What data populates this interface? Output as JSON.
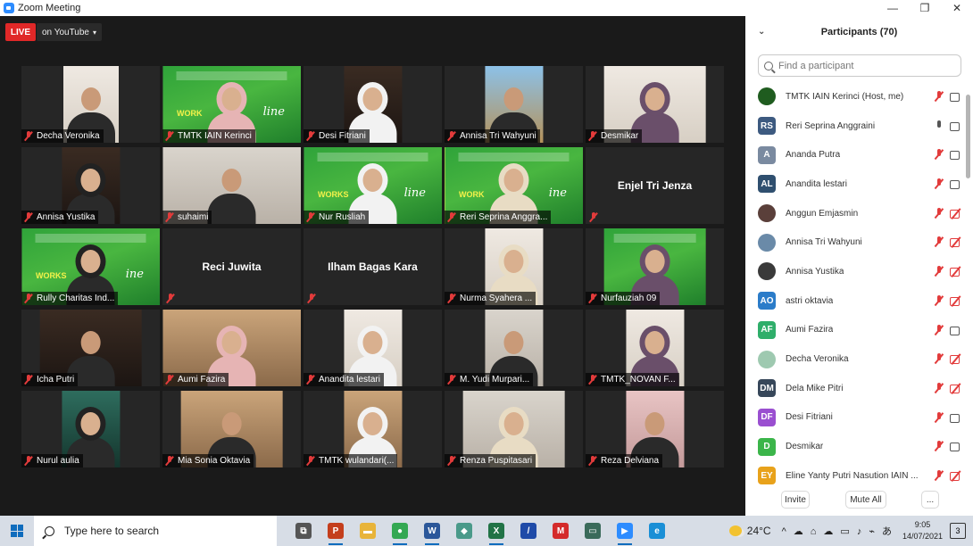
{
  "window": {
    "title": "Zoom Meeting",
    "minimize": "—",
    "restore": "❐",
    "close": "✕"
  },
  "live": {
    "badge": "LIVE",
    "destination": "on YouTube",
    "caret": "▾"
  },
  "tiles": [
    {
      "name": "Decha Veronika",
      "kind": "photo",
      "bg": "v-light",
      "video_width_pct": 40
    },
    {
      "name": "TMTK IAIN Kerinci",
      "kind": "video",
      "bg": "v-green",
      "overlay": "WORK",
      "overlay2": "line"
    },
    {
      "name": "Desi Fitriani",
      "kind": "video",
      "bg": "v-dark",
      "video_width_pct": 42
    },
    {
      "name": "Annisa Tri Wahyuni",
      "kind": "photo",
      "bg": "v-sky",
      "video_width_pct": 42
    },
    {
      "name": "Desmikar",
      "kind": "video",
      "bg": "v-light",
      "video_width_pct": 74
    },
    {
      "name": "Annisa Yustika",
      "kind": "photo",
      "bg": "v-dark",
      "video_width_pct": 42
    },
    {
      "name": "suhaimi",
      "kind": "video",
      "bg": "v-room"
    },
    {
      "name": "Nur Rusliah",
      "kind": "video",
      "bg": "v-green",
      "overlay": "WORKS",
      "overlay2": "line"
    },
    {
      "name": "Reri Seprina Anggra...",
      "kind": "video",
      "bg": "v-green",
      "overlay": "WORK",
      "overlay2": "ine",
      "active": true
    },
    {
      "name": "Enjel Tri Jenza",
      "kind": "nameonly"
    },
    {
      "name": "Rully Charitas Ind...",
      "kind": "video",
      "bg": "v-green",
      "overlay": "WORKS",
      "overlay2": "ine"
    },
    {
      "name": "Reci Juwita",
      "kind": "nameonly"
    },
    {
      "name": "Ilham Bagas Kara",
      "kind": "nameonly"
    },
    {
      "name": "Nurma Syahera ...",
      "kind": "photo",
      "bg": "v-light",
      "video_width_pct": 42
    },
    {
      "name": "Nurfauziah 09",
      "kind": "video",
      "bg": "v-green",
      "video_width_pct": 74
    },
    {
      "name": "Icha Putri",
      "kind": "video",
      "bg": "v-dark",
      "video_width_pct": 74
    },
    {
      "name": "Aumi Fazira",
      "kind": "video",
      "bg": "v-warm"
    },
    {
      "name": "Anandita lestari",
      "kind": "video",
      "bg": "v-light",
      "video_width_pct": 42
    },
    {
      "name": "M. Yudi Murpari...",
      "kind": "video",
      "bg": "v-room",
      "video_width_pct": 42
    },
    {
      "name": "TMTK_NOVAN F...",
      "kind": "video",
      "bg": "v-light",
      "video_width_pct": 42
    },
    {
      "name": "Nurul aulia",
      "kind": "video",
      "bg": "v-teal",
      "video_width_pct": 42
    },
    {
      "name": "Mia Sonia Oktavia",
      "kind": "video",
      "bg": "v-warm",
      "video_width_pct": 74
    },
    {
      "name": "TMTK wulandari(...",
      "kind": "video",
      "bg": "v-warm",
      "video_width_pct": 42
    },
    {
      "name": "Renza Puspitasari",
      "kind": "video",
      "bg": "v-room",
      "video_width_pct": 74
    },
    {
      "name": "Reza Delviana",
      "kind": "video",
      "bg": "v-pink",
      "video_width_pct": 42
    }
  ],
  "participants_panel": {
    "title": "Participants (70)",
    "collapse": "⌄",
    "search_placeholder": "Find a participant",
    "items": [
      {
        "name": "TMTK IAIN Kerinci (Host, me)",
        "initials": "",
        "color": "#1f5c1f",
        "mic": "off",
        "cam": "on"
      },
      {
        "name": "Reri Seprina Anggraini",
        "initials": "RS",
        "color": "#3d5a80",
        "mic": "on",
        "cam": "on"
      },
      {
        "name": "Ananda Putra",
        "initials": "A",
        "color": "#7a8aa0",
        "mic": "off",
        "cam": "on"
      },
      {
        "name": "Anandita lestari",
        "initials": "AL",
        "color": "#2f4f6f",
        "mic": "off",
        "cam": "on"
      },
      {
        "name": "Anggun Emjasmin",
        "initials": "",
        "color": "#5a3f3a",
        "mic": "off",
        "cam": "off"
      },
      {
        "name": "Annisa Tri Wahyuni",
        "initials": "",
        "color": "#6a8aa8",
        "mic": "off",
        "cam": "off"
      },
      {
        "name": "Annisa Yustika",
        "initials": "",
        "color": "#3a3a3a",
        "mic": "off",
        "cam": "off"
      },
      {
        "name": "astri oktavia",
        "initials": "AO",
        "color": "#2b7cc9",
        "mic": "off",
        "cam": "off"
      },
      {
        "name": "Aumi Fazira",
        "initials": "AF",
        "color": "#2fae6a",
        "mic": "off",
        "cam": "on"
      },
      {
        "name": "Decha Veronika",
        "initials": "",
        "color": "#9ec9b0",
        "mic": "off",
        "cam": "off"
      },
      {
        "name": "Dela Mike Pitri",
        "initials": "DM",
        "color": "#37475a",
        "mic": "off",
        "cam": "off"
      },
      {
        "name": "Desi Fitriani",
        "initials": "DF",
        "color": "#9a4fd0",
        "mic": "off",
        "cam": "on"
      },
      {
        "name": "Desmikar",
        "initials": "D",
        "color": "#3bb54a",
        "mic": "off",
        "cam": "on"
      },
      {
        "name": "Eline Yanty Putri Nasution IAIN ...",
        "initials": "EY",
        "color": "#e8a21b",
        "mic": "off",
        "cam": "off"
      }
    ],
    "invite": "Invite",
    "mute_all": "Mute All",
    "more": "..."
  },
  "taskbar": {
    "search_placeholder": "Type here to search",
    "apps": [
      {
        "name": "task-view",
        "label": "⧉",
        "color": "#555555"
      },
      {
        "name": "powerpoint",
        "label": "P",
        "color": "#c43e1c",
        "running": true
      },
      {
        "name": "file-explorer",
        "label": "▬",
        "color": "#e8b43a"
      },
      {
        "name": "chrome",
        "label": "●",
        "color": "#34a853",
        "running": true
      },
      {
        "name": "word",
        "label": "W",
        "color": "#2b579a",
        "running": true
      },
      {
        "name": "app-green",
        "label": "◆",
        "color": "#4a9a8a"
      },
      {
        "name": "excel",
        "label": "X",
        "color": "#217346",
        "running": true
      },
      {
        "name": "pen-app",
        "label": "/",
        "color": "#1e4aa8"
      },
      {
        "name": "red-app",
        "label": "M",
        "color": "#d42a2a"
      },
      {
        "name": "screen-app",
        "label": "▭",
        "color": "#3a6a5a"
      },
      {
        "name": "zoom",
        "label": "▶",
        "color": "#2d8cff",
        "running": true
      },
      {
        "name": "edge",
        "label": "e",
        "color": "#1a8fd6"
      }
    ],
    "temperature": "24°C",
    "tray": [
      "^",
      "☁",
      "⌂",
      "☁",
      "▭",
      "♪",
      "⌁",
      "あ"
    ],
    "time": "9:05",
    "date": "14/07/2021",
    "notifications": "3"
  }
}
